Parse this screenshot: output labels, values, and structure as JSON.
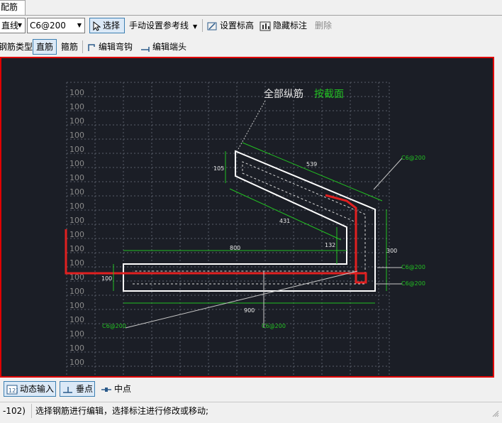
{
  "tab": {
    "label": "配筋"
  },
  "toolbar1": {
    "line_type": "直线",
    "rebar_spec": "C6@200",
    "select_label": "选择",
    "ref_line_label": "手动设置参考线",
    "set_elevation_label": "设置标高",
    "hide_annotation_label": "隐藏标注",
    "delete_label": "删除"
  },
  "toolbar2": {
    "rebar_type_label": "钢筋类型:",
    "straight_rebar": "直筋",
    "stirrup": "箍筋",
    "edit_hook": "编辑弯钩",
    "edit_end": "编辑端头"
  },
  "canvas": {
    "title_white": "全部纵筋",
    "title_green": "按截面",
    "grid_label": "100",
    "dims": {
      "d105": "105",
      "d539": "539",
      "d431": "431",
      "d800": "800",
      "d132": "132",
      "d100": "100",
      "d900": "900",
      "d300": "300"
    },
    "rebar_labels": {
      "r1": "C6@200",
      "r2": "C6@200",
      "r3": "C6@200",
      "r4": "C6@200",
      "r5": "C6@200"
    }
  },
  "bottom_toolbar": {
    "dynamic_input": "动态输入",
    "perpendicular": "垂点",
    "midpoint": "中点"
  },
  "statusbar": {
    "coord": "-102)",
    "message": "选择钢筋进行编辑，选择标注进行修改或移动;"
  },
  "colors": {
    "canvas_bg": "#1b1e26",
    "highlight_border": "#e00000",
    "annotation_green": "#22c022",
    "rebar_red": "#e02020"
  }
}
